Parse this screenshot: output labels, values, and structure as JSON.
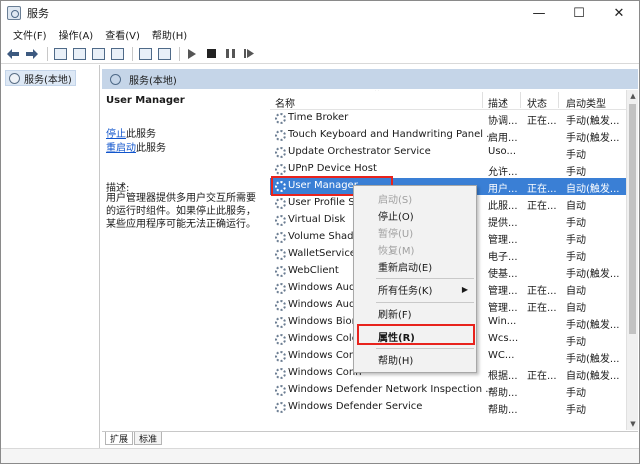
{
  "window": {
    "title": "服务",
    "minimize": "—",
    "maximize": "☐",
    "close": "✕"
  },
  "menu": [
    "文件(F)",
    "操作(A)",
    "查看(V)",
    "帮助(H)"
  ],
  "tree": {
    "root": "服务(本地)"
  },
  "main_header": "服务(本地)",
  "description": {
    "title": "User Manager",
    "stop_link": "停止",
    "stop_suffix": "此服务",
    "restart_link": "重启动",
    "restart_suffix": "此服务",
    "label": "描述:",
    "text": "用户管理器提供多用户交互所需要的运行时组件。如果停止此服务，某些应用程序可能无法正确运行。"
  },
  "list": {
    "columns": [
      "名称",
      "描述",
      "状态",
      "启动类型"
    ],
    "rows": [
      {
        "name": "Time Broker",
        "desc": "协调...",
        "status": "正在...",
        "startup": "手动(触发..."
      },
      {
        "name": "Touch Keyboard and Handwriting Panel ...",
        "desc": "启用...",
        "status": "",
        "startup": "手动(触发..."
      },
      {
        "name": "Update Orchestrator Service",
        "desc": "Uso...",
        "status": "",
        "startup": "手动"
      },
      {
        "name": "UPnP Device Host",
        "desc": "允许...",
        "status": "",
        "startup": "手动"
      },
      {
        "name": "User Manager",
        "desc": "用户...",
        "status": "正在...",
        "startup": "自动(触发..."
      },
      {
        "name": "User Profile S",
        "desc": "此服...",
        "status": "正在...",
        "startup": "自动"
      },
      {
        "name": "Virtual Disk",
        "desc": "提供...",
        "status": "",
        "startup": "手动"
      },
      {
        "name": "Volume Shado",
        "desc": "管理...",
        "status": "",
        "startup": "手动"
      },
      {
        "name": "WalletService",
        "desc": "电子...",
        "status": "",
        "startup": "手动"
      },
      {
        "name": "WebClient",
        "desc": "使基...",
        "status": "",
        "startup": "手动(触发..."
      },
      {
        "name": "Windows Aud",
        "desc": "管理...",
        "status": "正在...",
        "startup": "自动"
      },
      {
        "name": "Windows Aud",
        "desc": "管理...",
        "status": "正在...",
        "startup": "自动"
      },
      {
        "name": "Windows Bior",
        "desc": "Win...",
        "status": "",
        "startup": "手动(触发..."
      },
      {
        "name": "Windows Colo",
        "desc": "Wcs...",
        "status": "",
        "startup": "手动"
      },
      {
        "name": "Windows Conn",
        "desc": "WC...",
        "status": "",
        "startup": "手动(触发..."
      },
      {
        "name": "Windows Conn",
        "desc": "根据...",
        "status": "正在...",
        "startup": "自动(触发..."
      },
      {
        "name": "Windows Defender Network Inspection ...",
        "desc": "帮助...",
        "status": "",
        "startup": "手动"
      },
      {
        "name": "Windows Defender Service",
        "desc": "帮助...",
        "status": "",
        "startup": "手动"
      }
    ],
    "selected_index": 4
  },
  "context_menu": [
    {
      "label": "启动(S)",
      "disabled": true
    },
    {
      "label": "停止(O)",
      "disabled": false
    },
    {
      "label": "暂停(U)",
      "disabled": true
    },
    {
      "label": "恢复(M)",
      "disabled": true
    },
    {
      "label": "重新启动(E)",
      "disabled": false
    },
    {
      "label": "所有任务(K)",
      "disabled": false,
      "submenu": true
    },
    {
      "label": "刷新(F)",
      "disabled": false
    },
    {
      "label": "属性(R)",
      "disabled": false,
      "bold": true
    },
    {
      "label": "帮助(H)",
      "disabled": false
    }
  ],
  "tabs": [
    "扩展",
    "标准"
  ],
  "colors": {
    "selection": "#3a7fd5",
    "highlight_box": "#e8231d",
    "header_band": "#c5d5e8",
    "link": "#1155cc"
  },
  "icons": [
    "services-app-icon",
    "back-arrow-icon",
    "forward-arrow-icon",
    "play-icon",
    "stop-icon",
    "pause-icon",
    "restart-icon",
    "gear-icon"
  ]
}
